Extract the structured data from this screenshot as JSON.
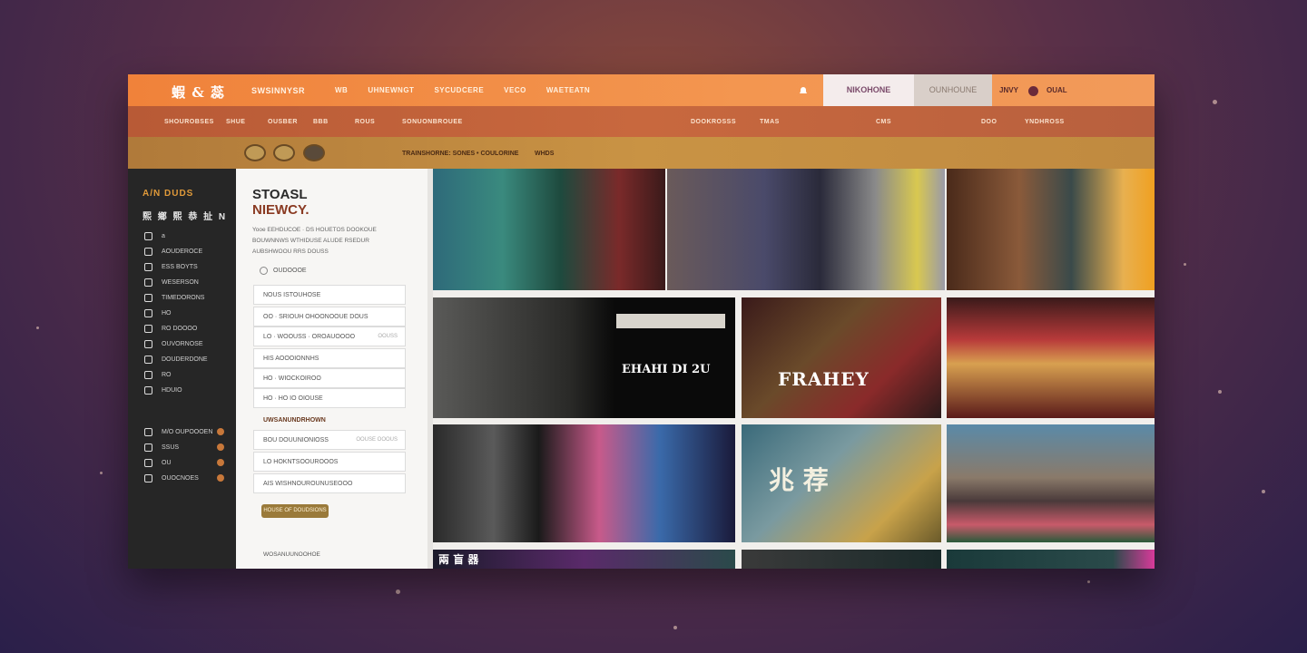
{
  "header": {
    "logo": "蝦 & 蕊",
    "brand_sub": "SWSINNYSR",
    "nav": [
      "WB",
      "UHNEWNGT",
      "SYCUDCERE",
      "VECO",
      "WAETEATN"
    ],
    "segment_active": "NIKOHONE",
    "segment_secondary": "OUNHOUNE",
    "right_label_1": "JNVY",
    "right_label_2": "OUAL"
  },
  "subnav": [
    "SHOUROBSES",
    "SHUE",
    "OUSBER",
    "BBB",
    "ROUS",
    "SONUONBROUEE",
    "DOOKROSSS",
    "TMAS",
    "CMS",
    "DOO",
    "YNDHROSS"
  ],
  "filterbar": {
    "label": "TRAINSHORNE: SONES • COULORINE",
    "label_2": "WHDS"
  },
  "sidebar": {
    "title": "A/N DUDS",
    "subtitle": "熙 鄉 熙 恭 扯 N",
    "items": [
      {
        "icon": "compass-icon",
        "label": "a"
      },
      {
        "icon": "arrow-icon",
        "label": "AOUDEROCE"
      },
      {
        "icon": "tag-icon",
        "label": "ESS BOYTS"
      },
      {
        "icon": "wave-icon",
        "label": "WESERSON"
      },
      {
        "icon": "grid-icon",
        "label": "TIMEDORONS"
      },
      {
        "icon": "trend-icon",
        "label": "HO"
      },
      {
        "icon": "chart-icon",
        "label": "RO DOOOO"
      },
      {
        "icon": "drop-icon",
        "label": "OUVORNOSE"
      },
      {
        "icon": "flag-icon",
        "label": "DOUDERDONE"
      },
      {
        "icon": "fish-icon",
        "label": "RO"
      },
      {
        "icon": "link-icon",
        "label": "HDUIO"
      }
    ],
    "footer_items": [
      {
        "icon": "cart-icon",
        "label": "M/O OUPOOOEN"
      },
      {
        "icon": "bag-icon",
        "label": "SSUS"
      },
      {
        "icon": "gift-icon",
        "label": "OU"
      },
      {
        "icon": "link-icon",
        "label": "OUOCNOES"
      }
    ]
  },
  "panel": {
    "title_line1": "STOASL",
    "title_line2": "NIEWCY.",
    "description": "Yooe EEHDUCOE · DS HOUETOS DOOKOUE BOUWNNWS WTHIDUSE ALUDE RSEDUR AUBSHWOOU RRS DOUSS",
    "radio_label": "OUDOOOE",
    "fields": [
      {
        "label": "NOUS ISTOUHOSE",
        "hint": ""
      },
      {
        "label": "OO · SRIOUH OHOONOOUE DOUS",
        "hint": ""
      },
      {
        "label": "LO · WOOUSS · OROAUOOOO",
        "hint": "OOUSS"
      },
      {
        "label": "HIS AOOOIONNHS",
        "hint": ""
      },
      {
        "label": "HO · WIOCKOIROO",
        "hint": ""
      },
      {
        "label": "HO · HO IO OIOUSE",
        "hint": ""
      }
    ],
    "section_label": "UWSANUNDRHOWN",
    "fields_2": [
      {
        "label": "BOU DOUUNIONIOSS",
        "hint": "OOUSE OOOUS"
      },
      {
        "label": "LO HOKNTSOOUROOOS",
        "hint": ""
      },
      {
        "label": "AIS WISHNOUROUNUSEOOO",
        "hint": ""
      }
    ],
    "button_label": "HOUSE OF DOUDSIONS",
    "footer": "WOSANUUNOOHOE"
  },
  "tiles": [
    {
      "name": "tile-portrait-collage",
      "overlay": ""
    },
    {
      "name": "tile-crowd-collage",
      "overlay": ""
    },
    {
      "name": "tile-portrait-right",
      "overlay": ""
    },
    {
      "name": "tile-crowd-dark",
      "overlay": "EHAHI  DI 2U"
    },
    {
      "name": "tile-fraher-poster",
      "overlay": "FRAHEY"
    },
    {
      "name": "tile-flowers-stage",
      "overlay": ""
    },
    {
      "name": "tile-city-collage",
      "overlay": ""
    },
    {
      "name": "tile-script-poster",
      "overlay": "兆 荐"
    },
    {
      "name": "tile-garden-figures",
      "overlay": ""
    },
    {
      "name": "tile-bottom-strip-1",
      "overlay": "兩 盲 器"
    },
    {
      "name": "tile-bottom-strip-2",
      "overlay": ""
    },
    {
      "name": "tile-bottom-strip-3",
      "overlay": ""
    }
  ],
  "colors": {
    "topbar": "#f0823a",
    "subbar": "#b85a36",
    "filterbar": "#c99344",
    "sidebar": "#262626",
    "accent": "#9a7a3a"
  }
}
